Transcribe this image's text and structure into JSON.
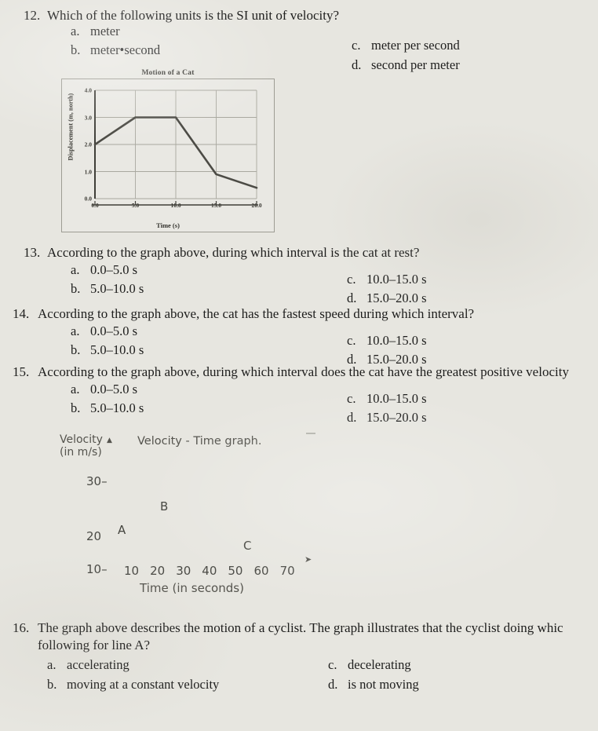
{
  "page": {
    "background_color": "#e7e6e0",
    "ink_color": "#1d1d1c"
  },
  "questions": [
    {
      "number": "12.",
      "text": "Which of the following units is the SI unit of velocity?",
      "choices": {
        "a": "meter",
        "b": "meter•second",
        "c": "meter per second",
        "d": "second per meter"
      },
      "letters": {
        "a": "a.",
        "b": "b.",
        "c": "c.",
        "d": "d."
      }
    },
    {
      "number": "13.",
      "text": "According to the graph above, during which interval is the cat at rest?",
      "choices": {
        "a": "0.0–5.0 s",
        "b": "5.0–10.0 s",
        "c": "10.0–15.0 s",
        "d": "15.0–20.0 s"
      },
      "letters": {
        "a": "a.",
        "b": "b.",
        "c": "c.",
        "d": "d."
      }
    },
    {
      "number": "14.",
      "text": "According to the graph above, the cat has the fastest speed during which interval?",
      "choices": {
        "a": "0.0–5.0 s",
        "b": "5.0–10.0 s",
        "c": "10.0–15.0 s",
        "d": "15.0–20.0 s"
      },
      "letters": {
        "a": "a.",
        "b": "b.",
        "c": "c.",
        "d": "d."
      }
    },
    {
      "number": "15.",
      "text": "According to the graph above, during which interval does the cat have the greatest positive velocity",
      "choices": {
        "a": "0.0–5.0 s",
        "b": "5.0–10.0 s",
        "c": "10.0–15.0 s",
        "d": "15.0–20.0 s"
      },
      "letters": {
        "a": "a.",
        "b": "b.",
        "c": "c.",
        "d": "d."
      }
    },
    {
      "number": "16.",
      "text_line1": "The graph above describes the motion of a cyclist. The graph illustrates that the cyclist doing whic",
      "text_line2": "following for line A?",
      "choices": {
        "a": "accelerating",
        "b": "moving at a constant velocity",
        "c": "decelerating",
        "d": "is not moving"
      },
      "letters": {
        "a": "a.",
        "b": "b.",
        "c": "c.",
        "d": "d."
      }
    }
  ],
  "chart_data": [
    {
      "type": "line",
      "id": "motion-of-a-cat",
      "title": "Motion of a Cat",
      "xlabel": "Time (s)",
      "ylabel": "Displacement (m, north)",
      "x": [
        0.0,
        5.0,
        10.0,
        15.0,
        20.0
      ],
      "values": [
        2.0,
        3.0,
        3.0,
        0.9,
        0.4
      ],
      "xlim": [
        0.0,
        20.0
      ],
      "ylim": [
        0.0,
        4.0
      ],
      "xticks": [
        "0.0",
        "5.0",
        "10.0",
        "15.0",
        "20.0"
      ],
      "xtick_values": [
        0.0,
        5.0,
        10.0,
        15.0,
        20.0
      ],
      "yticks": [
        "0.0",
        "1.0",
        "2.0",
        "3.0",
        "4.0"
      ],
      "ytick_values": [
        0.0,
        1.0,
        2.0,
        3.0,
        4.0
      ],
      "grid": true,
      "legend": "none",
      "line_color": "#4c4b45"
    },
    {
      "type": "line",
      "id": "velocity-time-graph",
      "title": "Velocity - Time graph.",
      "xlabel": "Time (in seconds)",
      "ylabel": "Velocity (in m/s)",
      "ylabel_line1": "Velocity",
      "ylabel_line2": "(in m/s)",
      "xticks": [
        "10",
        "20",
        "30",
        "40",
        "50",
        "60",
        "70"
      ],
      "xtick_values": [
        10,
        20,
        30,
        40,
        50,
        60,
        70
      ],
      "yticks": [
        "30",
        "20",
        "10"
      ],
      "ytick_values": [
        30,
        20,
        10
      ],
      "xlim": [
        0,
        75
      ],
      "ylim": [
        0,
        35
      ],
      "grid": false,
      "legend": "none",
      "annotations": [
        {
          "label": "A",
          "x": 15,
          "y": 18
        },
        {
          "label": "B",
          "x": 33,
          "y": 23
        },
        {
          "label": "C",
          "x": 55,
          "y": 12
        }
      ],
      "note": "Faded scan: only segment labels A, B, C and axis tick labels are legible; plotted lines are not visible."
    }
  ]
}
